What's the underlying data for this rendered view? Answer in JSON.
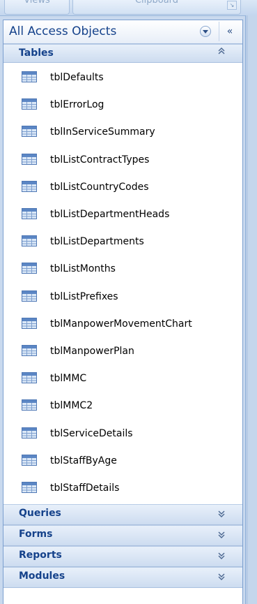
{
  "ribbon": {
    "groups": [
      {
        "label": "Views"
      },
      {
        "label": "Clipboard"
      }
    ]
  },
  "nav_pane": {
    "title": "All Access Objects",
    "collapse_glyph": "«",
    "tables": {
      "title": "Tables",
      "chevron": "≈",
      "items": [
        {
          "label": "tblDefaults",
          "icon": "table-icon"
        },
        {
          "label": "tblErrorLog",
          "icon": "table-icon"
        },
        {
          "label": "tblInServiceSummary",
          "icon": "table-icon"
        },
        {
          "label": "tblListContractTypes",
          "icon": "table-icon"
        },
        {
          "label": "tblListCountryCodes",
          "icon": "table-icon"
        },
        {
          "label": "tblListDepartmentHeads",
          "icon": "table-icon"
        },
        {
          "label": "tblListDepartments",
          "icon": "table-icon"
        },
        {
          "label": "tblListMonths",
          "icon": "table-icon"
        },
        {
          "label": "tblListPrefixes",
          "icon": "table-icon"
        },
        {
          "label": "tblManpowerMovementChart",
          "icon": "table-icon"
        },
        {
          "label": "tblManpowerPlan",
          "icon": "table-icon"
        },
        {
          "label": "tblMMC",
          "icon": "table-icon"
        },
        {
          "label": "tblMMC2",
          "icon": "table-icon"
        },
        {
          "label": "tblServiceDetails",
          "icon": "table-icon"
        },
        {
          "label": "tblStaffByAge",
          "icon": "table-icon"
        },
        {
          "label": "tblStaffDetails",
          "icon": "table-icon"
        }
      ]
    },
    "groups": [
      {
        "title": "Queries",
        "chevron": "≈"
      },
      {
        "title": "Forms",
        "chevron": "≈"
      },
      {
        "title": "Reports",
        "chevron": "≈"
      },
      {
        "title": "Modules",
        "chevron": "≈"
      }
    ]
  },
  "colors": {
    "title_blue": "#15428b",
    "pane_border": "#7b9fcf",
    "group_header_top": "#e8f0fa",
    "group_header_bottom": "#cddcf0"
  }
}
